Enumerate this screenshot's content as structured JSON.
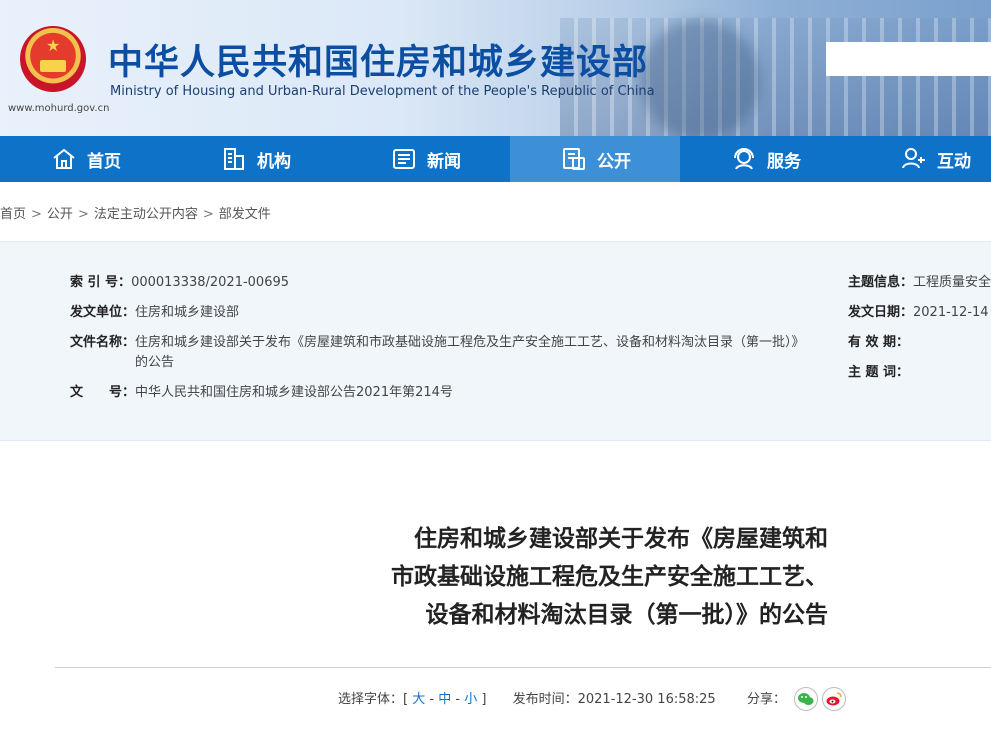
{
  "header": {
    "title_cn": "中华人民共和国住房和城乡建设部",
    "title_en": "Ministry of Housing and Urban-Rural Development of the People's Republic of China",
    "site_url": "www.mohurd.gov.cn",
    "emblem_icon": "national-emblem-icon"
  },
  "nav": {
    "items": [
      {
        "label": "首页",
        "icon": "home-icon"
      },
      {
        "label": "机构",
        "icon": "building-icon"
      },
      {
        "label": "新闻",
        "icon": "news-icon"
      },
      {
        "label": "公开",
        "icon": "document-icon"
      },
      {
        "label": "服务",
        "icon": "service-icon"
      },
      {
        "label": "互动",
        "icon": "user-chat-icon"
      }
    ],
    "active": "公开",
    "color": "#0f72c9",
    "active_color": "#3d8fd6"
  },
  "breadcrumb": [
    "首页",
    "公开",
    "法定主动公开内容",
    "部发文件"
  ],
  "breadcrumb_sep": ">",
  "meta": {
    "index_label": "索 引 号：",
    "index_value": "000013338/2021-00695",
    "unit_label": "发文单位：",
    "unit_value": "住房和城乡建设部",
    "filename_label": "文件名称：",
    "filename_value_line1": "住房和城乡建设部关于发布《房屋建筑和市政基础设施工程危及生产安全施工工艺、设备和材料淘汰目录（第一批）》",
    "filename_value_line2": "的公告",
    "docno_label": "文　　号：",
    "docno_value": "中华人民共和国住房和城乡建设部公告2021年第214号",
    "topic_label": "主题信息：",
    "topic_value": "工程质量安全",
    "date_label": "发文日期：",
    "date_value": "2021-12-14",
    "valid_label": "有 效 期：",
    "valid_value": "",
    "keyword_label": "主 题 词：",
    "keyword_value": ""
  },
  "article": {
    "title_line1": "住房和城乡建设部关于发布《房屋建筑和",
    "title_line2": "市政基础设施工程危及生产安全施工工艺、",
    "title_line3": "设备和材料淘汰目录（第一批）》的公告",
    "font_size_label": "选择字体：[",
    "font_large": "大",
    "font_medium": "中",
    "font_small": "小",
    "font_sep": "-",
    "font_end": "]",
    "publish_label": "发布时间：",
    "publish_time": "2021-12-30 16:58:25",
    "share_label": "分享：",
    "share_wechat_icon": "wechat-icon",
    "share_weibo_icon": "weibo-icon"
  }
}
